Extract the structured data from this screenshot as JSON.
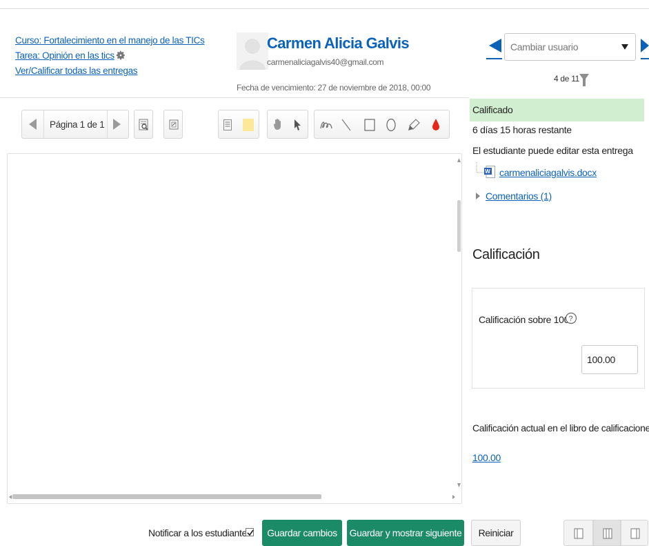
{
  "header": {
    "course_link": "Curso: Fortalecimiento en el manejo de las TICs",
    "assignment_link": "Tarea: Opinión en las tics",
    "view_all_link": "Ver/Calificar todas las entregas",
    "user_name": "Carmen Alicia Galvis",
    "user_email": "carmenaliciagalvis40@gmail.com",
    "due_date": "Fecha de vencimiento: 27 de noviembre de 2018, 00:00"
  },
  "user_nav": {
    "select_placeholder": "Cambiar usuario",
    "counter": "4 de 11"
  },
  "toolbar": {
    "page_label": "Página 1 de 1",
    "icons": [
      "search-comments-icon",
      "expand-icon",
      "comment-icon",
      "sticky-note-icon",
      "hand-icon",
      "select-arrow-icon",
      "pen-icon",
      "line-icon",
      "rectangle-icon",
      "oval-icon",
      "highlighter-icon",
      "color-drop-icon"
    ],
    "drop_color": "#e8271a"
  },
  "status": {
    "graded": "Calificado",
    "time_left": "6 días 15 horas restante",
    "edit_note": "El estudiante puede editar esta entrega",
    "file_name": "carmenaliciagalvis.docx",
    "comments_link": "Comentarios (1)",
    "graded_bg": "#d2eed0"
  },
  "grade": {
    "heading": "Calificación",
    "label": "Calificación sobre 100",
    "value": "100.00",
    "current_label": "Calificación actual en el libro de calificaciones",
    "current_value": "100.00"
  },
  "actions": {
    "notify_label": "Notificar a los estudiantes",
    "notify_checked": true,
    "save": "Guardar cambios",
    "save_next": "Guardar y mostrar siguiente",
    "reset": "Reiniciar",
    "accent": "#1b8a67",
    "link_color": "#0b62b8"
  }
}
